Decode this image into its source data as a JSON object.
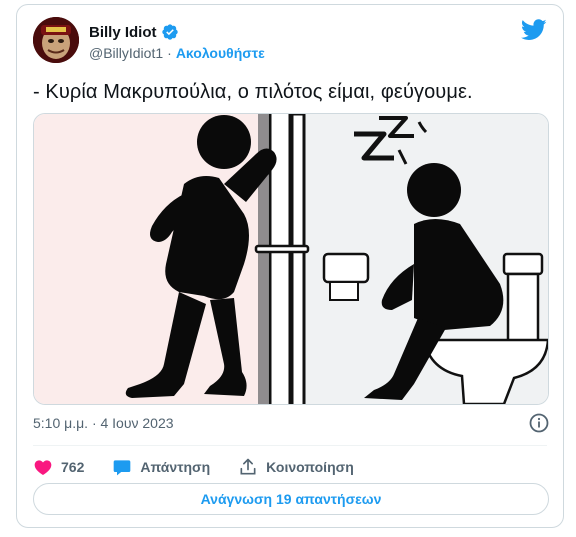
{
  "user": {
    "display_name": "Billy Idiot",
    "handle": "@BillyIdiot1",
    "separator": "·",
    "follow_label": "Ακολουθήστε",
    "verified": true
  },
  "tweet": {
    "text": "- Κυρία Μακρυπούλια, ο πιλότος είμαι, φεύγουμε.",
    "timestamp": "5:10 μ.μ. · 4 Ιουν 2023"
  },
  "actions": {
    "likes_count": "762",
    "reply_label": "Απάντηση",
    "share_label": "Κοινοποίηση"
  },
  "read_replies_label": "Ανάγνωση 19 απαντήσεων",
  "colors": {
    "accent": "#1d9bf0",
    "like": "#f91880",
    "text": "#0f1419",
    "muted": "#536471",
    "border": "#cfd9de"
  },
  "icons": {
    "verified": "verified-badge-icon",
    "twitter": "twitter-bird-icon",
    "info": "info-icon",
    "like": "heart-icon",
    "reply": "speech-bubble-icon",
    "share": "share-upload-icon"
  }
}
